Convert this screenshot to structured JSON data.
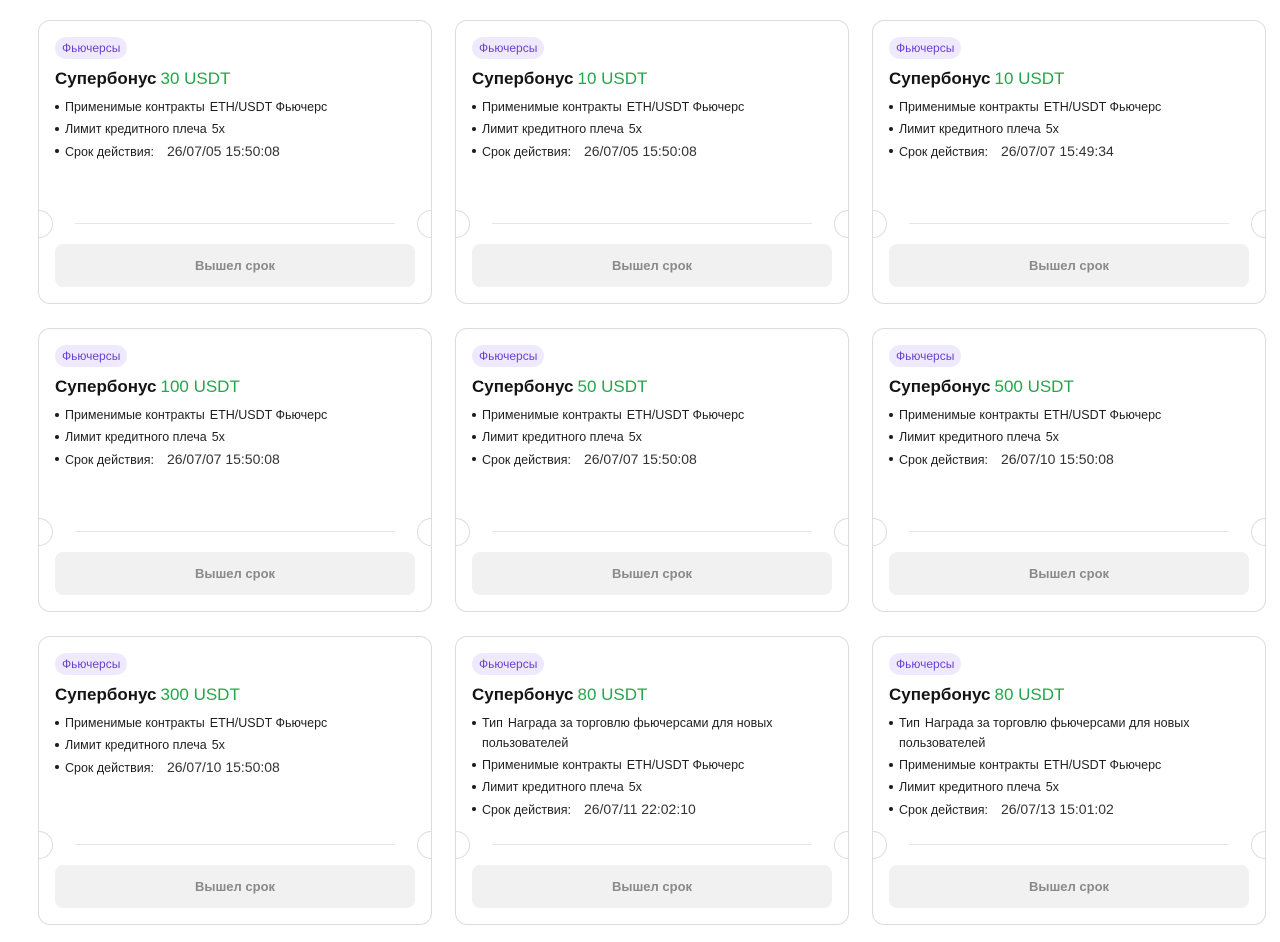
{
  "cards": [
    {
      "tag": "Фьючерсы",
      "title": "Супербонус",
      "amount": "30 USDT",
      "details": [
        {
          "k": "Применимые контракты",
          "v": "ETH/USDT Фьючерс"
        },
        {
          "k": "Лимит кредитного плеча",
          "v": "5x"
        },
        {
          "k": "Срок действия:",
          "v": "26/07/05 15:50:08",
          "date": true
        }
      ],
      "button": "Вышел срок"
    },
    {
      "tag": "Фьючерсы",
      "title": "Супербонус",
      "amount": "10 USDT",
      "details": [
        {
          "k": "Применимые контракты",
          "v": "ETH/USDT Фьючерс"
        },
        {
          "k": "Лимит кредитного плеча",
          "v": "5x"
        },
        {
          "k": "Срок действия:",
          "v": "26/07/05 15:50:08",
          "date": true
        }
      ],
      "button": "Вышел срок"
    },
    {
      "tag": "Фьючерсы",
      "title": "Супербонус",
      "amount": "10 USDT",
      "details": [
        {
          "k": "Применимые контракты",
          "v": "ETH/USDT Фьючерс"
        },
        {
          "k": "Лимит кредитного плеча",
          "v": "5x"
        },
        {
          "k": "Срок действия:",
          "v": "26/07/07 15:49:34",
          "date": true
        }
      ],
      "button": "Вышел срок"
    },
    {
      "tag": "Фьючерсы",
      "title": "Супербонус",
      "amount": "100 USDT",
      "details": [
        {
          "k": "Применимые контракты",
          "v": "ETH/USDT Фьючерс"
        },
        {
          "k": "Лимит кредитного плеча",
          "v": "5x"
        },
        {
          "k": "Срок действия:",
          "v": "26/07/07 15:50:08",
          "date": true
        }
      ],
      "button": "Вышел срок"
    },
    {
      "tag": "Фьючерсы",
      "title": "Супербонус",
      "amount": "50 USDT",
      "details": [
        {
          "k": "Применимые контракты",
          "v": "ETH/USDT Фьючерс"
        },
        {
          "k": "Лимит кредитного плеча",
          "v": "5x"
        },
        {
          "k": "Срок действия:",
          "v": "26/07/07 15:50:08",
          "date": true
        }
      ],
      "button": "Вышел срок"
    },
    {
      "tag": "Фьючерсы",
      "title": "Супербонус",
      "amount": "500 USDT",
      "details": [
        {
          "k": "Применимые контракты",
          "v": "ETH/USDT Фьючерс"
        },
        {
          "k": "Лимит кредитного плеча",
          "v": "5x"
        },
        {
          "k": "Срок действия:",
          "v": "26/07/10 15:50:08",
          "date": true
        }
      ],
      "button": "Вышел срок"
    },
    {
      "tag": "Фьючерсы",
      "title": "Супербонус",
      "amount": "300 USDT",
      "details": [
        {
          "k": "Применимые контракты",
          "v": "ETH/USDT Фьючерс"
        },
        {
          "k": "Лимит кредитного плеча",
          "v": "5x"
        },
        {
          "k": "Срок действия:",
          "v": "26/07/10 15:50:08",
          "date": true
        }
      ],
      "button": "Вышел срок"
    },
    {
      "tag": "Фьючерсы",
      "title": "Супербонус",
      "amount": "80 USDT",
      "details": [
        {
          "k": "Тип",
          "v": "Награда за торговлю фьючерсами для новых пользователей"
        },
        {
          "k": "Применимые контракты",
          "v": "ETH/USDT Фьючерс"
        },
        {
          "k": "Лимит кредитного плеча",
          "v": "5x"
        },
        {
          "k": "Срок действия:",
          "v": "26/07/11 22:02:10",
          "date": true
        }
      ],
      "button": "Вышел срок"
    },
    {
      "tag": "Фьючерсы",
      "title": "Супербонус",
      "amount": "80 USDT",
      "details": [
        {
          "k": "Тип",
          "v": "Награда за торговлю фьючерсами для новых пользователей"
        },
        {
          "k": "Применимые контракты",
          "v": "ETH/USDT Фьючерс"
        },
        {
          "k": "Лимит кредитного плеча",
          "v": "5x"
        },
        {
          "k": "Срок действия:",
          "v": "26/07/13 15:01:02",
          "date": true
        }
      ],
      "button": "Вышел срок"
    }
  ]
}
